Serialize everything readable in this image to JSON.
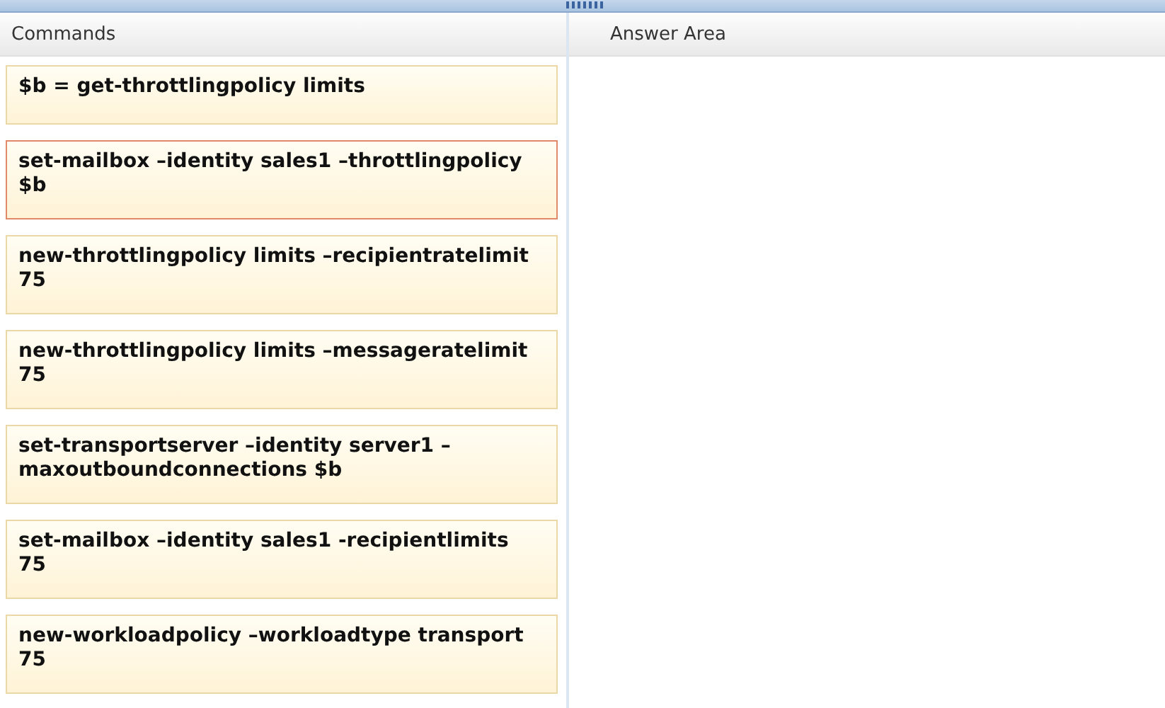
{
  "commands_panel": {
    "title": "Commands",
    "items": [
      {
        "text": "$b = get-throttlingpolicy limits",
        "selected": false
      },
      {
        "text": "set-mailbox –identity sales1 –throttlingpolicy\n$b",
        "selected": true
      },
      {
        "text": "new-throttlingpolicy limits –recipientratelimit\n75",
        "selected": false
      },
      {
        "text": "new-throttlingpolicy limits –messageratelimit\n75",
        "selected": false
      },
      {
        "text": "set-transportserver –identity server1 –\nmaxoutboundconnections $b",
        "selected": false
      },
      {
        "text": "set-mailbox –identity sales1 -recipientlimits\n75",
        "selected": false
      },
      {
        "text": "new-workloadpolicy –workloadtype transport\n75",
        "selected": false
      }
    ]
  },
  "answer_panel": {
    "title": "Answer Area"
  }
}
